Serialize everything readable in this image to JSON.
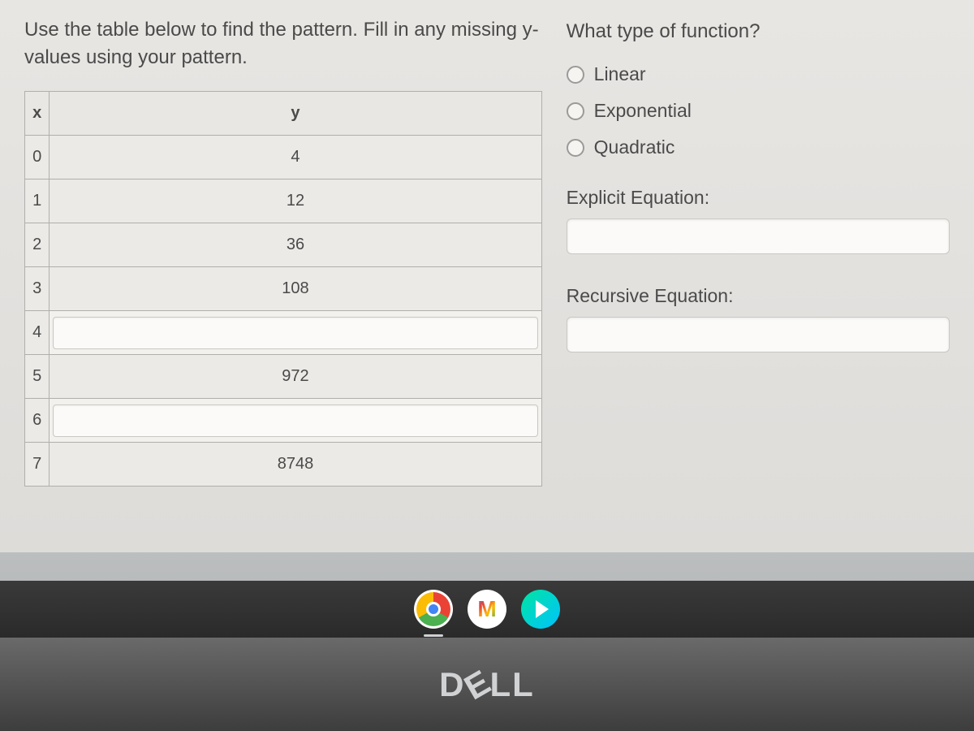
{
  "instructions": "Use the table below to find the pattern. Fill in any missing y-values using your pattern.",
  "table": {
    "headers": {
      "x": "x",
      "y": "y"
    },
    "rows": [
      {
        "x": "0",
        "y": "4",
        "y_editable": false
      },
      {
        "x": "1",
        "y": "12",
        "y_editable": false
      },
      {
        "x": "2",
        "y": "36",
        "y_editable": false
      },
      {
        "x": "3",
        "y": "108",
        "y_editable": false
      },
      {
        "x": "4",
        "y": "",
        "y_editable": true
      },
      {
        "x": "5",
        "y": "972",
        "y_editable": false
      },
      {
        "x": "6",
        "y": "",
        "y_editable": true
      },
      {
        "x": "7",
        "y": "8748",
        "y_editable": false
      }
    ]
  },
  "question": {
    "title": "What type of function?",
    "options": [
      "Linear",
      "Exponential",
      "Quadratic"
    ]
  },
  "explicit": {
    "label": "Explicit Equation:",
    "value": ""
  },
  "recursive": {
    "label": "Recursive Equation:",
    "value": ""
  },
  "taskbar": {
    "icons": [
      "chrome",
      "gmail",
      "play"
    ]
  },
  "logo": "DELL",
  "chart_data": {
    "type": "table",
    "title": "Function pattern table",
    "columns": [
      "x",
      "y"
    ],
    "rows": [
      [
        0,
        4
      ],
      [
        1,
        12
      ],
      [
        2,
        36
      ],
      [
        3,
        108
      ],
      [
        4,
        null
      ],
      [
        5,
        972
      ],
      [
        6,
        null
      ],
      [
        7,
        8748
      ]
    ]
  }
}
